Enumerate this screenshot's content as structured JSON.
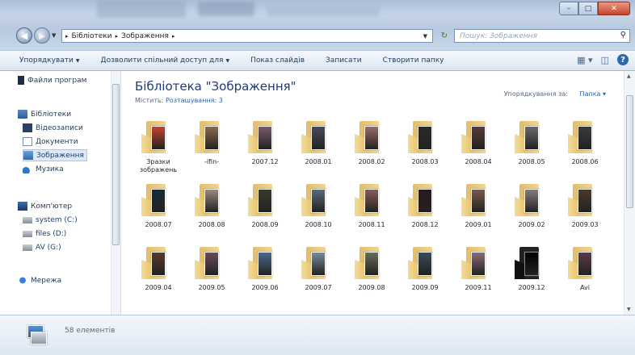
{
  "window": {
    "caption_buttons": [
      "–",
      "□",
      "✕"
    ]
  },
  "nav": {
    "breadcrumb": [
      "Бібліотеки",
      "Зображення"
    ],
    "search_placeholder": "Пошук: Зображення"
  },
  "toolbar": {
    "organize": "Упорядкувати",
    "share": "Дозволити спільний доступ для",
    "slideshow": "Показ слайдів",
    "burn": "Записати",
    "new_folder": "Створити папку"
  },
  "sidebar": {
    "items": [
      {
        "label": "Файли програм",
        "icon": "program-files-icon",
        "level": 0
      },
      {
        "label": "Бібліотеки",
        "icon": "libraries-icon",
        "level": 0
      },
      {
        "label": "Відеозаписи",
        "icon": "video-icon",
        "level": 1
      },
      {
        "label": "Документи",
        "icon": "documents-icon",
        "level": 1
      },
      {
        "label": "Зображення",
        "icon": "pictures-icon",
        "level": 1,
        "selected": true
      },
      {
        "label": "Музика",
        "icon": "music-icon",
        "level": 1
      },
      {
        "label": "Комп'ютер",
        "icon": "computer-icon",
        "level": 0
      },
      {
        "label": "system (C:)",
        "icon": "drive-icon",
        "level": 1
      },
      {
        "label": "files (D:)",
        "icon": "drive-icon",
        "level": 1
      },
      {
        "label": "AV (G:)",
        "icon": "drive-icon",
        "level": 1
      },
      {
        "label": "Мережа",
        "icon": "network-icon",
        "level": 0
      }
    ]
  },
  "content": {
    "title": "Бібліотека \"Зображення\"",
    "locations_label": "Містить:",
    "locations_link": "Розташування: 3",
    "arrange_label": "Упорядкування за:",
    "arrange_value": "Папка",
    "folders": [
      {
        "label": "Зразки зображень",
        "photo": "#c8402c"
      },
      {
        "label": "-ifin-",
        "photo": "#8a6a4e"
      },
      {
        "label": "2007.12",
        "photo": "#7a5a6a"
      },
      {
        "label": "2008.01",
        "photo": "#4a4a5a"
      },
      {
        "label": "2008.02",
        "photo": "#9a6a6a"
      },
      {
        "label": "2008.03",
        "photo": "#2a2a2a"
      },
      {
        "label": "2008.04",
        "photo": "#5a3a3a"
      },
      {
        "label": "2008.05",
        "photo": "#6a6a6a"
      },
      {
        "label": "2008.06",
        "photo": "#3a3a3a"
      },
      {
        "label": "2008.07",
        "photo": "#1a2a3a"
      },
      {
        "label": "2008.08",
        "photo": "#9a8a7a"
      },
      {
        "label": "2008.09",
        "photo": "#3a3a2a"
      },
      {
        "label": "2008.10",
        "photo": "#5a6a7a"
      },
      {
        "label": "2008.11",
        "photo": "#8a5a5a"
      },
      {
        "label": "2008.12",
        "photo": "#2a1a1a"
      },
      {
        "label": "2009.01",
        "photo": "#7a5a4a"
      },
      {
        "label": "2009.02",
        "photo": "#8a7a7a"
      },
      {
        "label": "2009.03",
        "photo": "#4a3a2a"
      },
      {
        "label": "2009.04",
        "photo": "#5a3a2a"
      },
      {
        "label": "2009.05",
        "photo": "#6a4a5a"
      },
      {
        "label": "2009.06",
        "photo": "#4a6a8a"
      },
      {
        "label": "2009.07",
        "photo": "#7a8a9a"
      },
      {
        "label": "2009.08",
        "photo": "#6a6a5a"
      },
      {
        "label": "2009.09",
        "photo": "#3a4a5a"
      },
      {
        "label": "2009.11",
        "photo": "#8a6a7a"
      },
      {
        "label": "2009.12",
        "photo": "#000000",
        "black": true
      },
      {
        "label": "Avi",
        "photo": "#5a3a4a"
      }
    ]
  },
  "details": {
    "count": "58 елементів"
  }
}
